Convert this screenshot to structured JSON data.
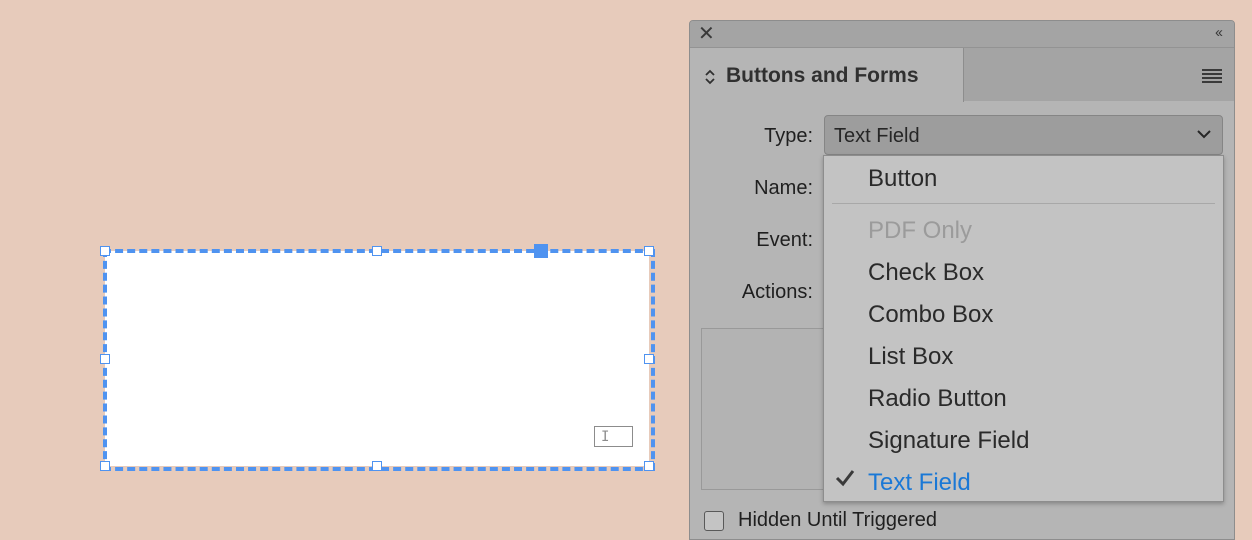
{
  "canvas": {
    "frame_border_color": "#4f93f0",
    "field_icon": "text-cursor-icon"
  },
  "panel": {
    "close_icon": "close-icon",
    "collapse_icon": "collapse-icon",
    "collapse_glyph": "‹‹",
    "tab_title": "Buttons and Forms",
    "menu_icon": "panel-menu-icon",
    "type_label": "Type:",
    "type_value": "Text Field",
    "name_label": "Name:",
    "event_label": "Event:",
    "actions_label": "Actions:",
    "hidden_until_triggered_label": "Hidden Until Triggered"
  },
  "dropdown": {
    "options": [
      {
        "label": "Button",
        "state": "enabled"
      },
      {
        "label": "PDF Only",
        "state": "disabled"
      },
      {
        "label": "Check Box",
        "state": "enabled"
      },
      {
        "label": "Combo Box",
        "state": "enabled"
      },
      {
        "label": "List Box",
        "state": "enabled"
      },
      {
        "label": "Radio Button",
        "state": "enabled"
      },
      {
        "label": "Signature Field",
        "state": "enabled"
      },
      {
        "label": "Text Field",
        "state": "selected"
      }
    ],
    "selected_color": "#1a78d6"
  }
}
